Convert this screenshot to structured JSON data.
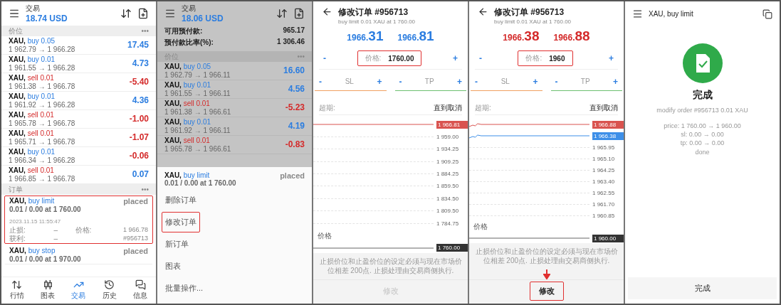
{
  "panels": [
    {
      "kind": "trade",
      "dimmed": false,
      "header": {
        "title": "交易",
        "balance": "18.74 USD"
      },
      "sections": [
        {
          "title": "价位",
          "more": "•••",
          "kind": "positions",
          "items": [
            {
              "symbol": "XAU,",
              "label": "buy 0.05",
              "kind": "buy",
              "prices": "1 962.79 → 1 966.28",
              "profit": "17.45",
              "color": "#2b7de0"
            },
            {
              "symbol": "XAU,",
              "label": "buy 0.01",
              "kind": "buy",
              "prices": "1 961.55 → 1 966.28",
              "profit": "4.73",
              "color": "#2b7de0"
            },
            {
              "symbol": "XAU,",
              "label": "sell 0.01",
              "kind": "sell",
              "prices": "1 961.38 → 1 966.78",
              "profit": "-5.40",
              "color": "#d42a2a"
            },
            {
              "symbol": "XAU,",
              "label": "buy 0.01",
              "kind": "buy",
              "prices": "1 961.92 → 1 966.28",
              "profit": "4.36",
              "color": "#2b7de0"
            },
            {
              "symbol": "XAU,",
              "label": "sell 0.01",
              "kind": "sell",
              "prices": "1 965.78 → 1 966.78",
              "profit": "-1.00",
              "color": "#d42a2a"
            },
            {
              "symbol": "XAU,",
              "label": "sell 0.01",
              "kind": "sell",
              "prices": "1 965.71 → 1 966.78",
              "profit": "-1.07",
              "color": "#d42a2a"
            },
            {
              "symbol": "XAU,",
              "label": "buy 0.01",
              "kind": "buy",
              "prices": "1 966.34 → 1 966.28",
              "profit": "-0.06",
              "color": "#d42a2a"
            },
            {
              "symbol": "XAU,",
              "label": "sell 0.01",
              "kind": "sell",
              "prices": "1 966.85 → 1 966.78",
              "profit": "0.07",
              "color": "#2b7de0"
            }
          ]
        },
        {
          "title": "订单",
          "more": "•••",
          "kind": "orders",
          "items": [
            {
              "symbol": "XAU,",
              "label": "buy limit",
              "detail": "0.01 / 0.00 at 1 760.00",
              "status": "placed",
              "highlighted": true,
              "time": "2023.11.15 11:55:47",
              "stop_loss": {
                "label": "止损:",
                "value": "–"
              },
              "price": {
                "label": "价格:",
                "value": "1 966.78"
              },
              "take_profit": {
                "label": "获利:",
                "value": "–"
              },
              "ticket": "#956713"
            },
            {
              "symbol": "XAU,",
              "label": "buy stop",
              "detail": "0.01 / 0.00 at 1 970.00",
              "status": "placed",
              "highlighted": false
            }
          ]
        }
      ],
      "nav": [
        {
          "kind": "quotes",
          "label": "行情",
          "selected": false
        },
        {
          "kind": "chart",
          "label": "图表",
          "selected": false
        },
        {
          "kind": "trade",
          "label": "交易",
          "selected": true
        },
        {
          "kind": "history",
          "label": "历史",
          "selected": false
        },
        {
          "kind": "messages",
          "label": "信息",
          "selected": false
        }
      ]
    },
    {
      "kind": "trade",
      "dimmed": true,
      "header": {
        "title": "交易",
        "balance": "18.06 USD"
      },
      "account": [
        {
          "label": "可用预付款:",
          "value": "965.17"
        },
        {
          "label": "预付款比率(%):",
          "value": "1 306.46"
        }
      ],
      "sections": [
        {
          "title": "价位",
          "more": "•••",
          "kind": "positions",
          "items": [
            {
              "symbol": "XAU,",
              "label": "buy 0.05",
              "kind": "buy",
              "prices": "1 962.79 → 1 966.11",
              "profit": "16.60",
              "color": "#2b7de0"
            },
            {
              "symbol": "XAU,",
              "label": "buy 0.01",
              "kind": "buy",
              "prices": "1 961.55 → 1 966.11",
              "profit": "4.56",
              "color": "#2b7de0"
            },
            {
              "symbol": "XAU,",
              "label": "sell 0.01",
              "kind": "sell",
              "prices": "1 961.38 → 1 966.61",
              "profit": "-5.23",
              "color": "#d42a2a"
            },
            {
              "symbol": "XAU,",
              "label": "buy 0.01",
              "kind": "buy",
              "prices": "1 961.92 → 1 966.11",
              "profit": "4.19",
              "color": "#2b7de0"
            },
            {
              "symbol": "XAU,",
              "label": "sell 0.01",
              "kind": "sell",
              "prices": "1 965.78 → 1 966.61",
              "profit": "-0.83",
              "color": "#d42a2a"
            }
          ]
        }
      ],
      "sheet": {
        "symbol": "XAU,",
        "label": "buy limit",
        "detail": "0.01 / 0.00 at 1 760.00",
        "status": "placed",
        "items": [
          {
            "label": "删除订单",
            "highlighted": false
          },
          {
            "label": "修改订单",
            "highlighted": true
          },
          {
            "label": "新订单",
            "highlighted": false
          },
          {
            "label": "图表",
            "highlighted": false
          },
          {
            "label": "批量操作...",
            "highlighted": false
          }
        ]
      }
    },
    {
      "kind": "modify",
      "title": "修改订单 #956713",
      "subtitle": "buy limit 0.01 XAU at 1 760.00",
      "quotes": [
        {
          "base": "1966.",
          "big": "31",
          "color": "#2b7de0"
        },
        {
          "base": "1966.",
          "big": "81",
          "color": "#2b7de0"
        }
      ],
      "price_field": {
        "label": "价格:",
        "value": "1760.00",
        "minus": "-",
        "plus": "+",
        "highlighted": true
      },
      "levels": [
        {
          "label": "SL",
          "minus": "-",
          "plus": "+",
          "color": "#f0a060"
        },
        {
          "label": "TP",
          "minus": "-",
          "plus": "+",
          "color": "#6cc070"
        }
      ],
      "expiry": {
        "label": "超期:",
        "value": "直到取消"
      },
      "chart": {
        "tags": [
          {
            "value": "1 966.81",
            "color": "#d9534f",
            "history": false
          }
        ],
        "ticks": [
          "1 959.00",
          "1 934.25",
          "1 909.25",
          "1 884.25",
          "1 859.50",
          "1 834.50",
          "1 809.50",
          "1 784.75"
        ],
        "price_label": "价格",
        "price_tag": "1 760.00"
      },
      "note": "止损价位和止盈价位的设定必须与现在市场价位相差 200点. 止损处理由交易商侧执行.",
      "button": {
        "label": "修改",
        "disabled": true,
        "highlighted": false,
        "arrow": false
      }
    },
    {
      "kind": "modify",
      "title": "修改订单 #956713",
      "subtitle": "buy limit 0.01 XAU at 1 760.00",
      "quotes": [
        {
          "base": "1966.",
          "big": "38",
          "color": "#d42a2a"
        },
        {
          "base": "1966.",
          "big": "88",
          "color": "#d42a2a"
        }
      ],
      "price_field": {
        "label": "价格:",
        "value": "1960",
        "minus": "-",
        "plus": "+",
        "highlighted": true
      },
      "levels": [
        {
          "label": "SL",
          "minus": "-",
          "plus": "+",
          "color": "#f0a060"
        },
        {
          "label": "TP",
          "minus": "-",
          "plus": "+",
          "color": "#6cc070"
        }
      ],
      "expiry": {
        "label": "超期:",
        "value": "直到取消"
      },
      "chart": {
        "tags": [
          {
            "value": "1 966.88",
            "color": "#d9534f",
            "history": true
          },
          {
            "value": "1 966.38",
            "color": "#3d8fe8",
            "history": true
          }
        ],
        "ticks": [
          "1 965.95",
          "1 965.10",
          "1 964.25",
          "1 963.40",
          "1 962.55",
          "1 961.70",
          "1 960.85"
        ],
        "price_label": "价格",
        "price_tag": "1 960.00"
      },
      "note": "止损价位和止盈价位的设定必须与现在市场价位相差 200点. 止损处理由交易商侧执行.",
      "button": {
        "label": "修改",
        "disabled": false,
        "highlighted": true,
        "arrow": true
      }
    },
    {
      "kind": "result",
      "title": "XAU, buy limit",
      "heading": "完成",
      "summary": "modify order #956713 0.01 XAU",
      "lines": [
        "price: 1 760.00 → 1 960.00",
        "sl: 0.00 → 0.00",
        "tp: 0.00 → 0.00",
        "done"
      ],
      "button": "完成"
    }
  ]
}
